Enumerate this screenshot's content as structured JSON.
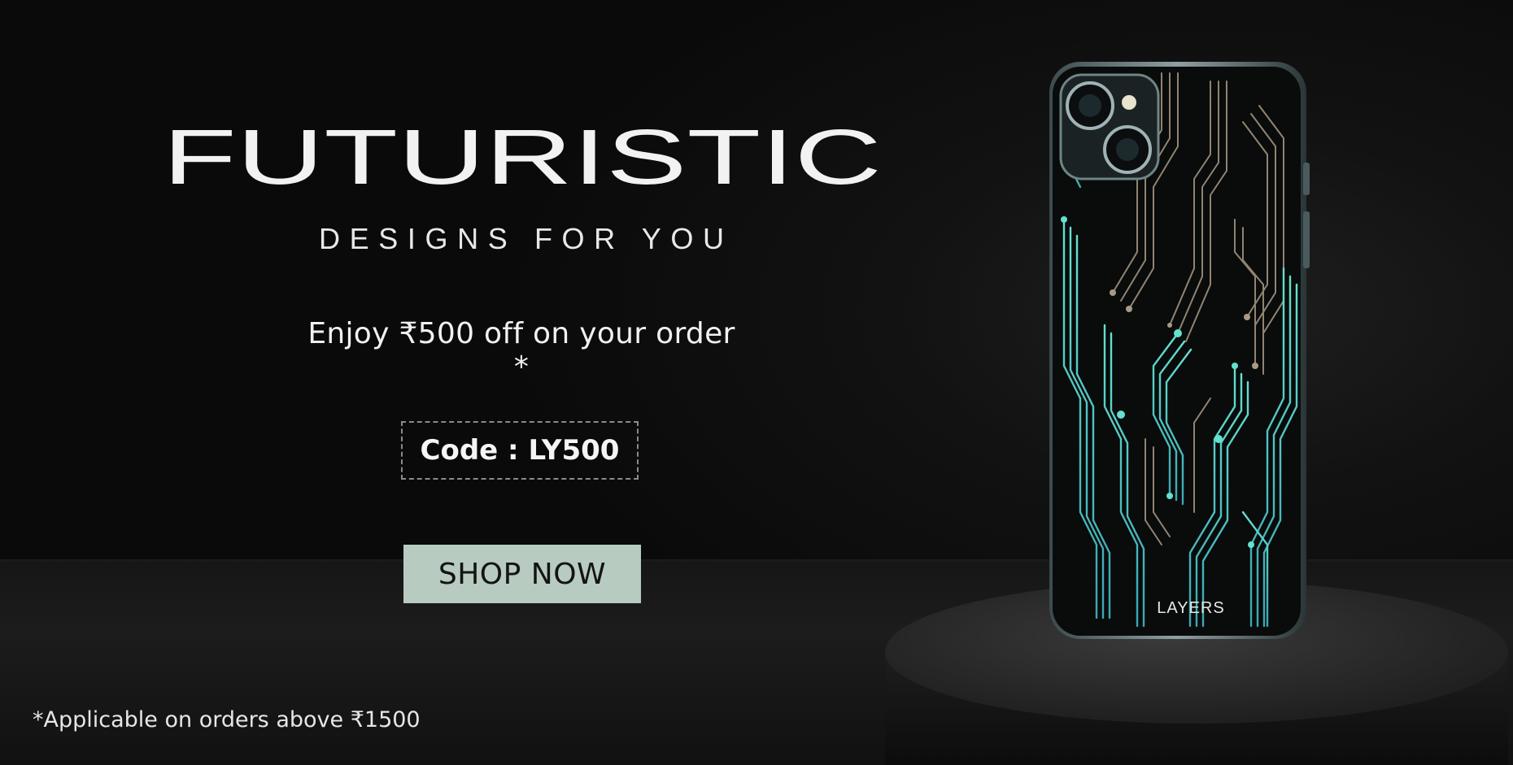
{
  "banner": {
    "headline": "FUTURISTIC",
    "subheadline": "DESIGNS FOR YOU",
    "offer_text": "Enjoy ₹500 off on your order *",
    "code_text": "Code : LY500",
    "cta_label": "SHOP NOW",
    "disclaimer": "*Applicable on orders above ₹1500"
  },
  "product": {
    "brand_mark": "LAYERS",
    "image_alt": "phone-with-circuit-skin"
  },
  "colors": {
    "background": "#0b0b0b",
    "text": "#f1f1f1",
    "cta_bg": "#b7cbc1",
    "cta_text": "#141414",
    "circuit_teal": "#5fd6c8",
    "circuit_bronze": "#a89a84"
  }
}
